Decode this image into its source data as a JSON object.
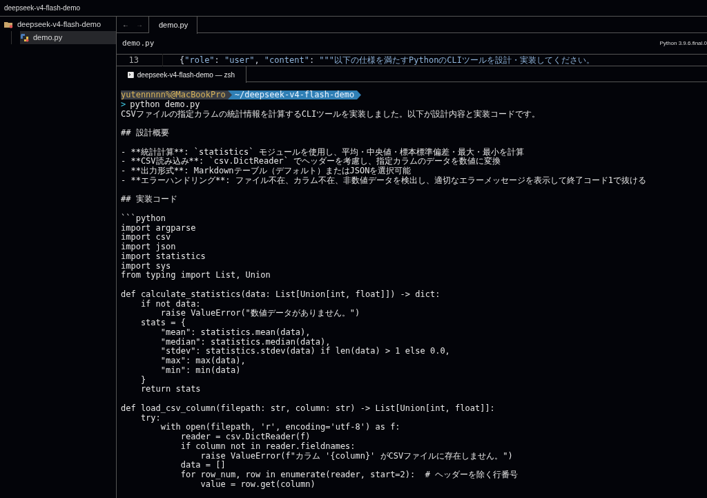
{
  "window": {
    "title": "deepseek-v4-flash-demo"
  },
  "sidebar": {
    "items": [
      {
        "label": "deepseek-v4-flash-demo",
        "kind": "folder",
        "selected": false,
        "children": [
          {
            "label": "demo.py",
            "kind": "python",
            "selected": true
          }
        ]
      }
    ]
  },
  "editor": {
    "nav": {
      "back": "←",
      "forward": "→"
    },
    "tabs": [
      {
        "label": "demo.py",
        "selected": true
      }
    ],
    "breadcrumb": "demo.py",
    "interpreter": "Python 3.9.6.final.0",
    "line": {
      "number": "13",
      "tokens": [
        {
          "kind": "punct",
          "text": "{"
        },
        {
          "kind": "string",
          "text": "\"role\""
        },
        {
          "kind": "punct",
          "text": ": "
        },
        {
          "kind": "string",
          "text": "\"user\""
        },
        {
          "kind": "punct",
          "text": ", "
        },
        {
          "kind": "string",
          "text": "\"content\""
        },
        {
          "kind": "punct",
          "text": ": "
        },
        {
          "kind": "string",
          "text": "\"\"\"以下の仕様を満たすPythonのCLIツールを設計・実装してください。"
        }
      ]
    }
  },
  "terminal": {
    "tab": {
      "label": "deepseek-v4-flash-demo — zsh",
      "selected": true
    },
    "prompt": {
      "user": "yutennnnn%@MacBookPro",
      "path": "~/deepseek-v4-flash-demo",
      "symbol": ">",
      "command": "python demo.py"
    },
    "lines": [
      {
        "kind": "text",
        "text": "CSVファイルの指定カラムの統計情報を計算するCLIツールを実装しました。以下が設計内容と実装コードです。"
      },
      {
        "kind": "blank"
      },
      {
        "kind": "text",
        "text": "## 設計概要"
      },
      {
        "kind": "blank"
      },
      {
        "kind": "text",
        "text": "- **統計計算**: `statistics` モジュールを使用し、平均・中央値・標本標準偏差・最大・最小を計算"
      },
      {
        "kind": "text",
        "text": "- **CSV読み込み**: `csv.DictReader` でヘッダーを考慮し、指定カラムのデータを数値に変換"
      },
      {
        "kind": "text",
        "text": "- **出力形式**: Markdownテーブル（デフォルト）またはJSONを選択可能"
      },
      {
        "kind": "text",
        "text": "- **エラーハンドリング**: ファイル不在、カラム不在、非数値データを検出し、適切なエラーメッセージを表示して終了コード1で抜ける"
      },
      {
        "kind": "blank"
      },
      {
        "kind": "text",
        "text": "## 実装コード"
      },
      {
        "kind": "blank"
      },
      {
        "kind": "text",
        "text": "```python"
      },
      {
        "kind": "text",
        "text": "import argparse"
      },
      {
        "kind": "text",
        "text": "import csv"
      },
      {
        "kind": "text",
        "text": "import json"
      },
      {
        "kind": "text",
        "text": "import statistics"
      },
      {
        "kind": "text",
        "text": "import sys"
      },
      {
        "kind": "text",
        "text": "from typing import List, Union"
      },
      {
        "kind": "blank"
      },
      {
        "kind": "text",
        "text": "def calculate_statistics(data: List[Union[int, float]]) -> dict:"
      },
      {
        "kind": "text",
        "text": "    if not data:"
      },
      {
        "kind": "text",
        "text": "        raise ValueError(\"数値データがありません。\")"
      },
      {
        "kind": "text",
        "text": "    stats = {"
      },
      {
        "kind": "text",
        "text": "        \"mean\": statistics.mean(data),"
      },
      {
        "kind": "text",
        "text": "        \"median\": statistics.median(data),"
      },
      {
        "kind": "text",
        "text": "        \"stdev\": statistics.stdev(data) if len(data) > 1 else 0.0,"
      },
      {
        "kind": "text",
        "text": "        \"max\": max(data),"
      },
      {
        "kind": "text",
        "text": "        \"min\": min(data)"
      },
      {
        "kind": "text",
        "text": "    }"
      },
      {
        "kind": "text",
        "text": "    return stats"
      },
      {
        "kind": "blank"
      },
      {
        "kind": "text",
        "text": "def load_csv_column(filepath: str, column: str) -> List[Union[int, float]]:"
      },
      {
        "kind": "text",
        "text": "    try:"
      },
      {
        "kind": "text",
        "text": "        with open(filepath, 'r', encoding='utf-8') as f:"
      },
      {
        "kind": "text",
        "text": "            reader = csv.DictReader(f)"
      },
      {
        "kind": "text",
        "text": "            if column not in reader.fieldnames:"
      },
      {
        "kind": "text",
        "text": "                raise ValueError(f\"カラム '{column}' がCSVファイルに存在しません。\")"
      },
      {
        "kind": "text",
        "text": "            data = []"
      },
      {
        "kind": "text",
        "text": "            for row_num, row in enumerate(reader, start=2):  # ヘッダーを除く行番号"
      },
      {
        "kind": "text",
        "text": "                value = row.get(column)"
      }
    ]
  }
}
